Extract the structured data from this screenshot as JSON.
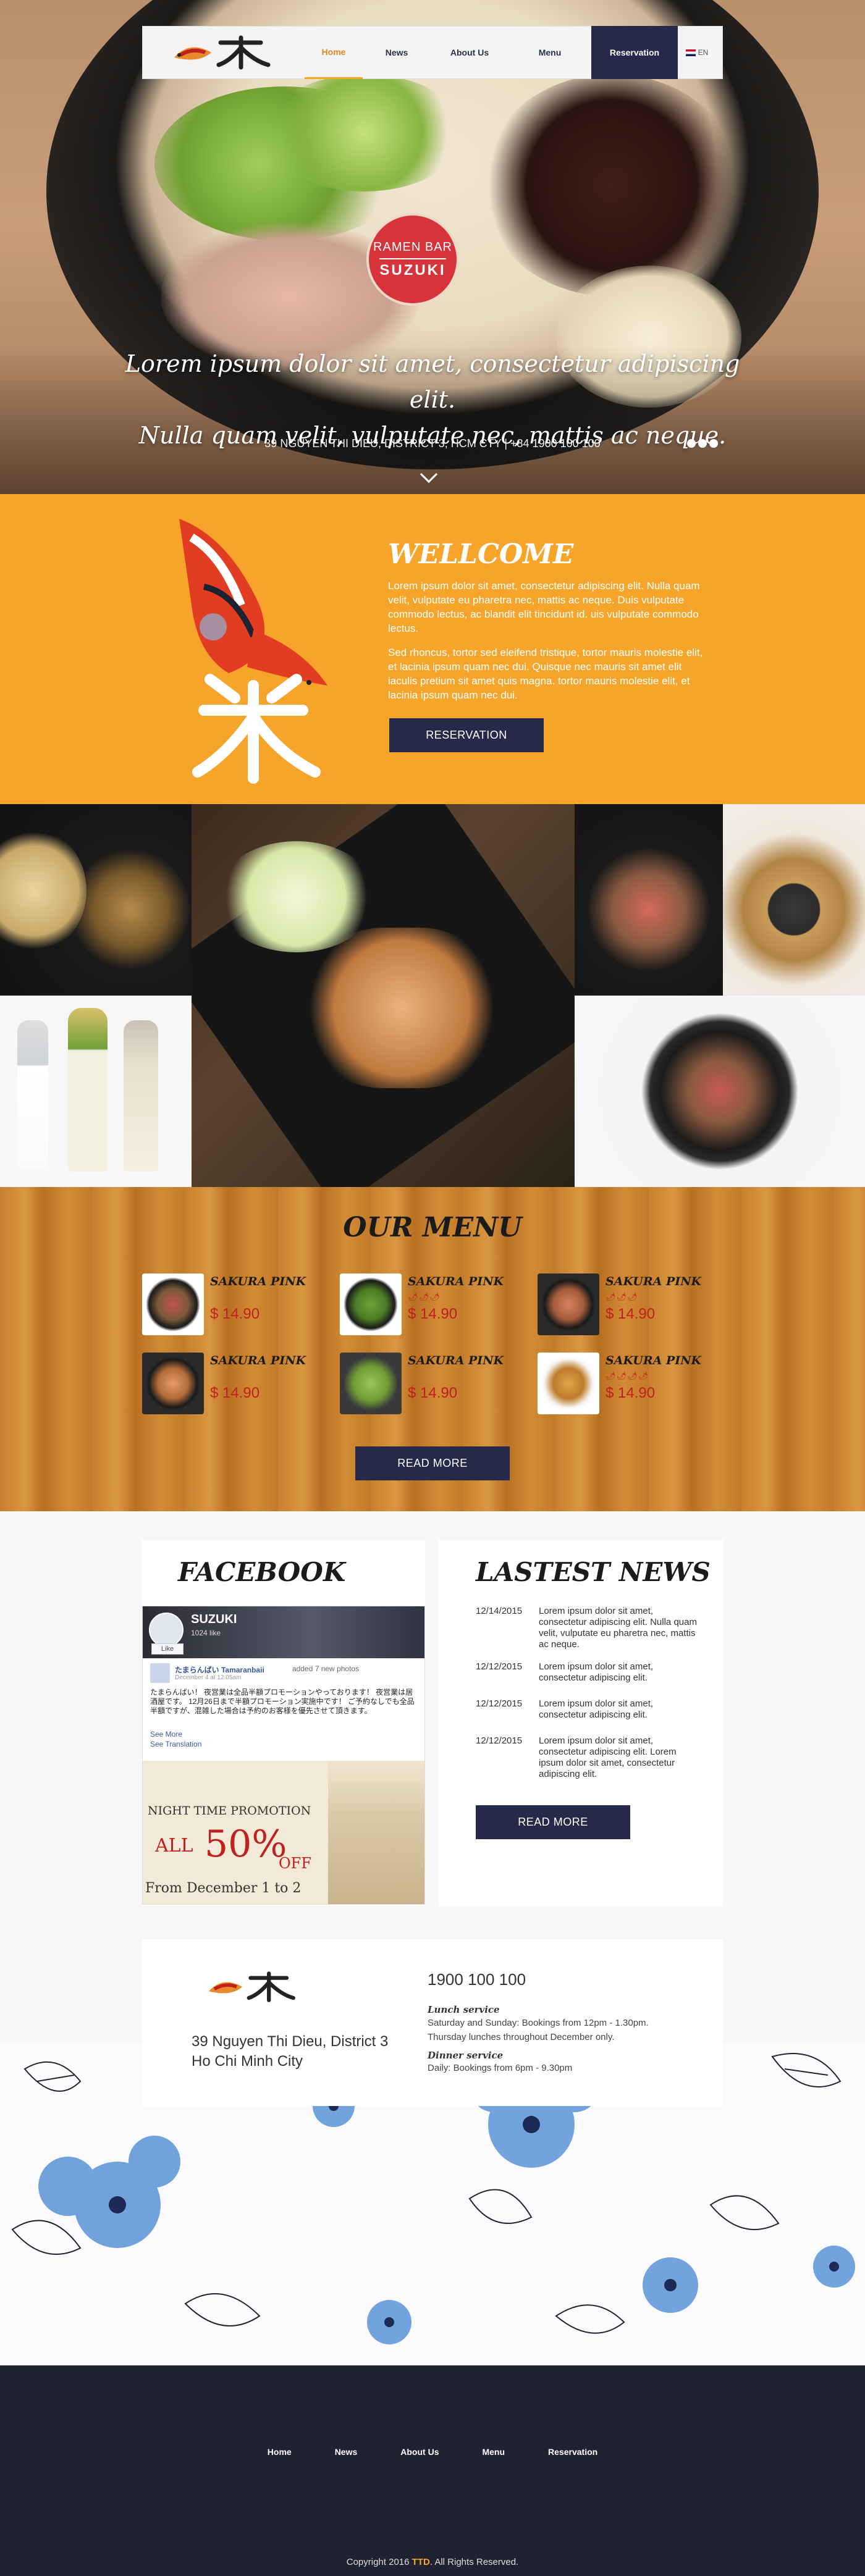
{
  "nav": {
    "items": [
      "Home",
      "News",
      "About Us",
      "Menu"
    ],
    "reservation": "Reservation",
    "lang": "EN"
  },
  "hero": {
    "badge_top": "RAMEN BAR",
    "badge_bottom": "SUZUKI",
    "tagline_1": "Lorem ipsum dolor sit amet, consectetur adipiscing elit.",
    "tagline_2": "Nulla quam velit, vulputate nec, mattis ac neque.",
    "address": "39 NGUYEN THI DIEU, DISTRICT 3, HCM CTY  |  +84 1900 100 100"
  },
  "welcome": {
    "title": "WELLCOME",
    "p1": "Lorem ipsum dolor sit amet, consectetur adipiscing elit. Nulla quam velit, vulputate eu pharetra nec, mattis ac neque. Duis vulputate commodo lectus, ac blandit elit tincidunt id. uis vulputate commodo lectus.",
    "p2": "Sed rhoncus, tortor sed eleifend tristique, tortor mauris molestie elit, et lacinia ipsum quam nec dui. Quisque nec mauris sit amet elit iaculis pretium sit amet quis magna. tortor mauris molestie elit, et lacinia ipsum quam nec dui.",
    "button": "RESERVATION"
  },
  "menu": {
    "title": "OUR MENU",
    "items": [
      {
        "name": "SAKURA PINK",
        "chili": "",
        "price": "$ 14.90"
      },
      {
        "name": "SAKURA PINK",
        "chili": "🌶🌶🌶",
        "price": "$ 14.90"
      },
      {
        "name": "SAKURA PINK",
        "chili": "🌶🌶🌶",
        "price": "$ 14.90"
      },
      {
        "name": "SAKURA PINK",
        "chili": "",
        "price": "$ 14.90"
      },
      {
        "name": "SAKURA PINK",
        "chili": "",
        "price": "$ 14.90"
      },
      {
        "name": "SAKURA PINK",
        "chili": "🌶🌶🌶🌶",
        "price": "$ 14.90"
      }
    ],
    "button": "READ MORE"
  },
  "facebook": {
    "title": "FACEBOOK",
    "page_name": "SUZUKI",
    "likes": "1024 like",
    "like_btn": "Like",
    "poster": "たまらんばい Tamaranbaii",
    "post_action": "added 7 new photos",
    "post_date": "December 4 at 12:05am",
    "post_text": "たまらんばい！ 夜営業は全品半額プロモーションやっております！ 夜営業は居酒屋です。 12月26日まで半額プロモーション実施中です！ ご予約なしでも全品半額ですが、混雑した場合は予約のお客様を優先させて頂きます。",
    "see_more": "See More",
    "see_translation": "See Translation",
    "promo_line1": "NIGHT TIME PROMOTION",
    "promo_all": "ALL",
    "promo_pct": "50%",
    "promo_off": "OFF",
    "promo_from": "From December 1 to 2"
  },
  "news": {
    "title": "LASTEST NEWS",
    "items": [
      {
        "date": "12/14/2015",
        "text": "Lorem ipsum dolor sit amet, consectetur adipiscing elit. Nulla quam velit, vulputate eu pharetra nec, mattis ac neque."
      },
      {
        "date": "12/12/2015",
        "text": "Lorem ipsum dolor sit amet, consectetur adipiscing elit."
      },
      {
        "date": "12/12/2015",
        "text": "Lorem ipsum dolor sit amet, consectetur adipiscing elit."
      },
      {
        "date": "12/12/2015",
        "text": "Lorem ipsum dolor sit amet, consectetur adipiscing elit. Lorem ipsum dolor sit amet, consectetur adipiscing elit."
      }
    ],
    "button": "READ MORE"
  },
  "contact": {
    "address_1": "39 Nguyen Thi Dieu, District 3",
    "address_2": "Ho Chi Minh City",
    "phone": "1900 100 100",
    "lunch_title": "Lunch service",
    "lunch_1": "Saturday and Sunday: Bookings from 12pm - 1.30pm.",
    "lunch_2": "Thursday lunches throughout December only.",
    "dinner_title": "Dinner service",
    "dinner_1": "Daily: Bookings from 6pm - 9.30pm"
  },
  "footer": {
    "items": [
      "Home",
      "News",
      "About Us",
      "Menu",
      "Reservation"
    ],
    "copy_pre": "Copyright 2016 ",
    "copy_brand": "TTD",
    "copy_post": ". All Rights Reserved."
  },
  "colors": {
    "accent": "#f6a52a",
    "navy": "#27294a",
    "price_red": "#c0201e",
    "footer": "#202231"
  }
}
